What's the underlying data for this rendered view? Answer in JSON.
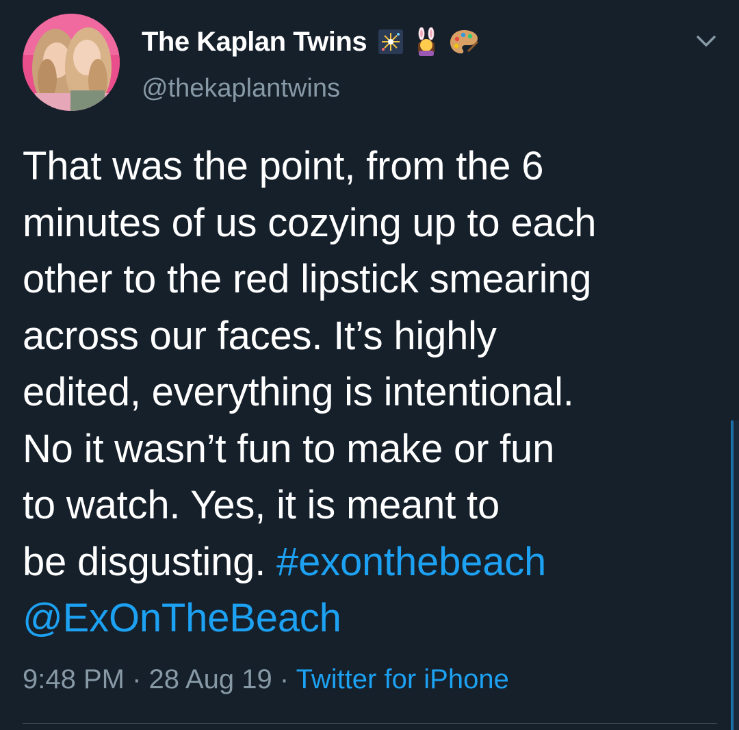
{
  "tweet": {
    "display_name": "The Kaplan Twins",
    "name_emojis": [
      "fireworks-icon",
      "bunny-ears-woman-icon",
      "artist-palette-icon"
    ],
    "handle": "@thekaplantwins",
    "text_lines": [
      "That was the point, from the 6",
      "minutes of us cozying up to each",
      "other to the red lipstick smearing",
      "across our faces. It’s highly",
      "edited, everything is intentional.",
      "No it wasn’t fun to make or fun",
      "to watch. Yes, it is meant to"
    ],
    "text_last_line_prefix": "be disgusting. ",
    "hashtag": "#exonthebeach",
    "mention": "@ExOnTheBeach",
    "time": "9:48 PM",
    "date": "28 Aug 19",
    "separator": "·",
    "source": "Twitter for iPhone"
  },
  "colors": {
    "background": "#15202b",
    "text": "#ffffff",
    "secondary_text": "#8899a6",
    "link": "#1da1f2",
    "divider": "#38444d"
  },
  "icons": {
    "menu_caret": "chevron-down-icon"
  }
}
